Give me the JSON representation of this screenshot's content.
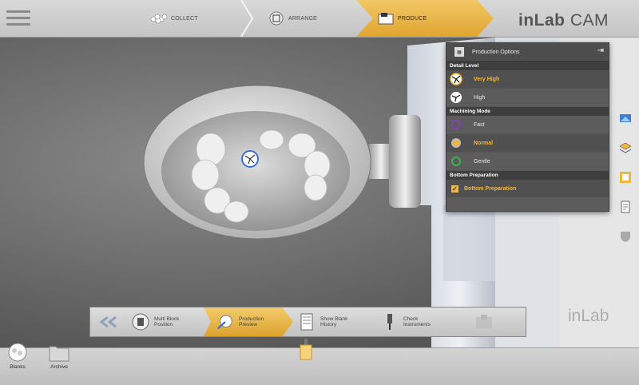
{
  "header": {
    "brand_light": "CAM",
    "brand_bold": "inLab",
    "steps": [
      {
        "label": "COLLECT",
        "icon": "collect-icon"
      },
      {
        "label": "ARRANGE",
        "icon": "arrange-icon"
      },
      {
        "label": "PRODUCE",
        "icon": "produce-icon",
        "active": true
      }
    ]
  },
  "panel": {
    "title": "Production Options",
    "detail_level": {
      "heading": "Detail Level",
      "options": [
        {
          "label": "Very High",
          "selected": true
        },
        {
          "label": "High",
          "selected": false
        }
      ]
    },
    "machining_mode": {
      "heading": "Machining Mode",
      "options": [
        {
          "label": "Fast",
          "color": "#8a3fb0",
          "selected": false
        },
        {
          "label": "Normal",
          "color": "#f1b73b",
          "selected": true
        },
        {
          "label": "Gentle",
          "color": "#3fb04a",
          "selected": false
        }
      ]
    },
    "bottom_preparation": {
      "heading": "Bottom Preparation",
      "checkbox_label": "Bottom Preparation",
      "checked": true
    }
  },
  "workflow": {
    "items": [
      {
        "label_1": "Multi Block",
        "label_2": "Position"
      },
      {
        "label_1": "Production",
        "label_2": "Preview",
        "active": true
      },
      {
        "label_1": "Show Blank",
        "label_2": "History"
      },
      {
        "label_1": "Check",
        "label_2": "Instruments"
      }
    ],
    "watermark": "inLab"
  },
  "bottom_tools": {
    "blanks": "Blanks",
    "archive": "Archive"
  },
  "colors": {
    "accent": "#f1b73b",
    "panel_bg": "#5c5c5c"
  }
}
